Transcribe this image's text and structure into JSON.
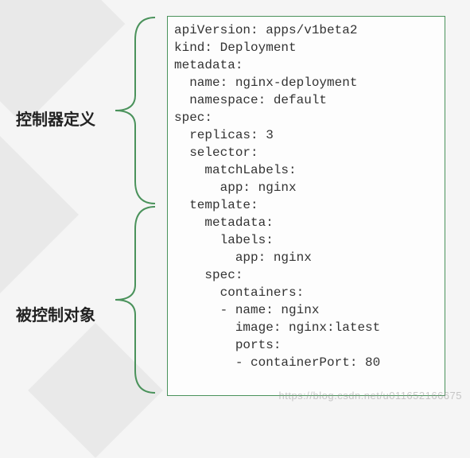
{
  "labels": {
    "controller_definition": "控制器定义",
    "controlled_object": "被控制对象"
  },
  "code_lines": [
    "apiVersion: apps/v1beta2",
    "kind: Deployment",
    "metadata:",
    "  name: nginx-deployment",
    "  namespace: default",
    "spec:",
    "  replicas: 3",
    "  selector:",
    "    matchLabels:",
    "      app: nginx",
    "  template:",
    "    metadata:",
    "      labels:",
    "        app: nginx",
    "    spec:",
    "      containers:",
    "      - name: nginx",
    "        image: nginx:latest",
    "        ports:",
    "        - containerPort: 80"
  ],
  "yaml": {
    "apiVersion": "apps/v1beta2",
    "kind": "Deployment",
    "metadata": {
      "name": "nginx-deployment",
      "namespace": "default"
    },
    "spec": {
      "replicas": 3,
      "selector": {
        "matchLabels": {
          "app": "nginx"
        }
      },
      "template": {
        "metadata": {
          "labels": {
            "app": "nginx"
          }
        },
        "spec": {
          "containers": [
            {
              "name": "nginx",
              "image": "nginx:latest",
              "ports": [
                {
                  "containerPort": 80
                }
              ]
            }
          ]
        }
      }
    }
  },
  "sections": {
    "controller_definition_lines": [
      0,
      1,
      2,
      3,
      4,
      5,
      6,
      7,
      8,
      9
    ],
    "controlled_object_lines": [
      10,
      11,
      12,
      13,
      14,
      15,
      16,
      17,
      18,
      19
    ]
  },
  "watermark": "https://blog.csdn.net/u011652166675",
  "colors": {
    "border": "#4a925b",
    "text": "#333333"
  }
}
